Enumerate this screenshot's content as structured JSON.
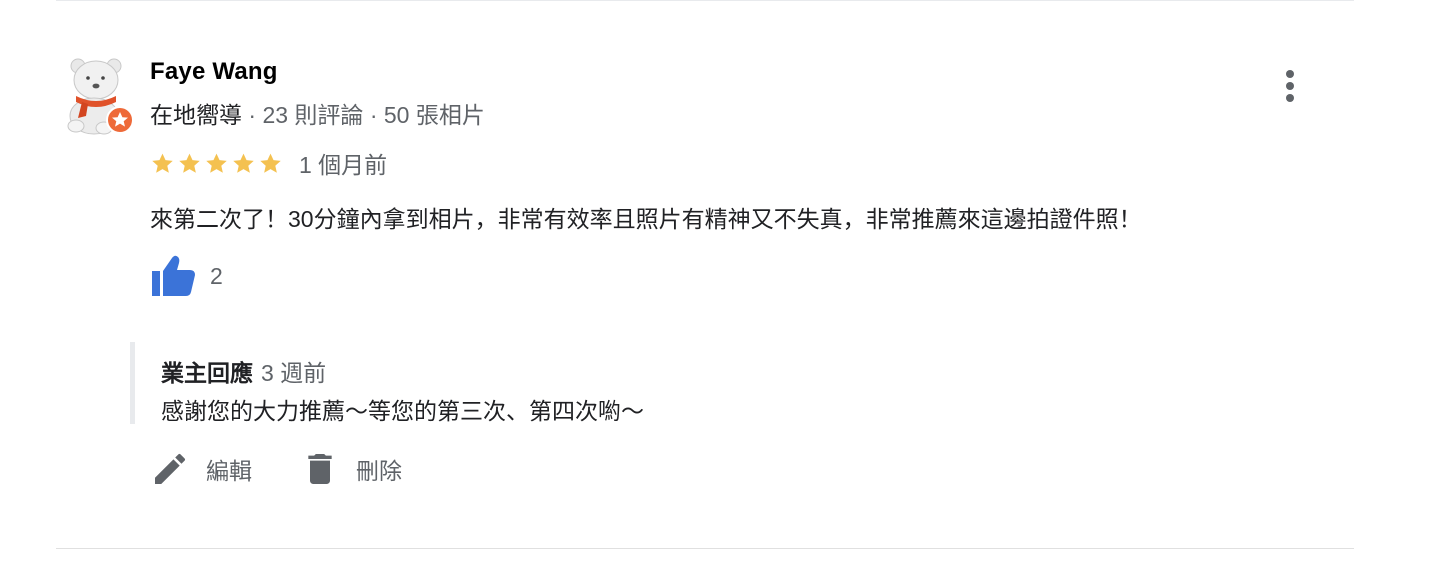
{
  "reviewer": {
    "name": "Faye Wang",
    "badge": "在地嚮導",
    "separator": " · ",
    "reviews": "23 則評論",
    "photos": "50 張相片"
  },
  "review": {
    "rating": 5,
    "time": "1 個月前",
    "text": "來第二次了！30分鐘內拿到相片，非常有效率且照片有精神又不失真，非常推薦來這邊拍證件照！",
    "likes": "2"
  },
  "owner_reply": {
    "label": "業主回應",
    "time": "3 週前",
    "text": "感謝您的大力推薦～等您的第三次、第四次喲～"
  },
  "actions": {
    "edit": "編輯",
    "delete": "刪除"
  },
  "colors": {
    "star": "#f4c150",
    "like": "#3b73d8",
    "guide_badge": "#ee6a39",
    "icon_gray": "#5f6368"
  }
}
